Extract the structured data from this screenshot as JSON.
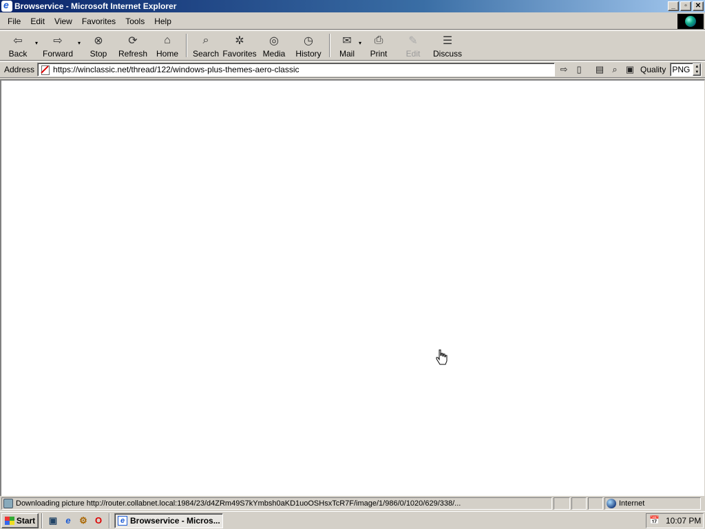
{
  "window": {
    "title": "Browservice - Microsoft Internet Explorer",
    "controls": {
      "minimize": "_",
      "maximize": "▫",
      "close": "✕"
    }
  },
  "menubar": {
    "items": [
      {
        "label": "File"
      },
      {
        "label": "Edit"
      },
      {
        "label": "View"
      },
      {
        "label": "Favorites"
      },
      {
        "label": "Tools"
      },
      {
        "label": "Help"
      }
    ]
  },
  "toolbar": {
    "back": "Back",
    "forward": "Forward",
    "stop": "Stop",
    "refresh": "Refresh",
    "home": "Home",
    "search": "Search",
    "favorites": "Favorites",
    "media": "Media",
    "history": "History",
    "mail": "Mail",
    "print": "Print",
    "edit": "Edit",
    "discuss": "Discuss",
    "dropdown_glyph": "▾"
  },
  "address": {
    "label": "Address",
    "url": "https://winclassic.net/thread/122/windows-plus-themes-aero-classic",
    "quality_label": "Quality",
    "quality_value": "PNG",
    "go_icon": "⇨",
    "bookmark_icon": "▯",
    "find_icon": "⌕",
    "clipboard_icon": "▣"
  },
  "statusbar": {
    "message": "Downloading picture http://router.collabnet.local:1984/23/d4ZRm49S7kYmbsh0aKD1uoOSHsxTcR7F/image/1/986/0/1020/629/338/...",
    "zone": "Internet"
  },
  "taskbar": {
    "start_label": "Start",
    "task_title": "Browservice - Micros...",
    "clock": "10:07 PM"
  },
  "colors": {
    "titlebar_start": "#0a246a",
    "titlebar_end": "#a6caf0",
    "face": "#d4d0c8"
  }
}
